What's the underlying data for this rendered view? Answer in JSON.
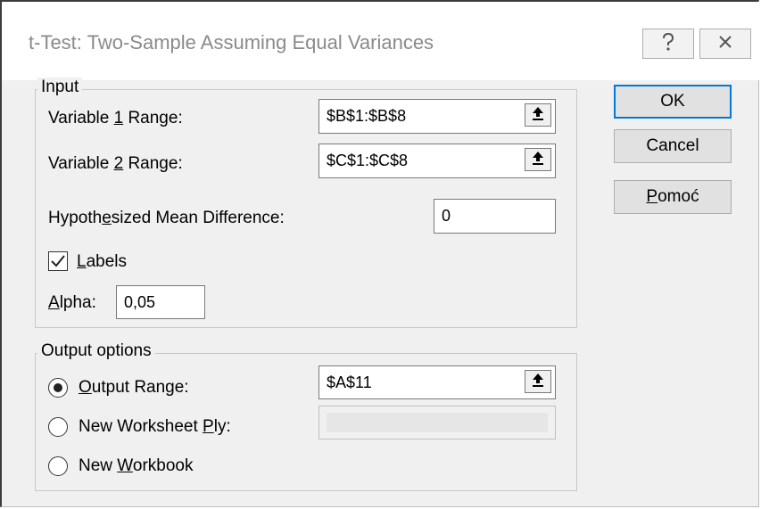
{
  "window": {
    "title": "t-Test: Two-Sample Assuming Equal Variances",
    "help_icon": "?",
    "close_icon": "X"
  },
  "input_group": {
    "legend": "Input",
    "var1_label_pre": "Variable ",
    "var1_label_key": "1",
    "var1_label_post": " Range:",
    "var1_value": "$B$1:$B$8",
    "var2_label_pre": "Variable ",
    "var2_label_key": "2",
    "var2_label_post": " Range:",
    "var2_value": "$C$1:$C$8",
    "hyp_label_pre": "Hypoth",
    "hyp_label_key": "e",
    "hyp_label_post": "sized Mean Difference:",
    "hyp_value": "0",
    "labels_key": "L",
    "labels_post": "abels",
    "labels_checked": true,
    "alpha_key": "A",
    "alpha_post": "lpha:",
    "alpha_value": "0,05"
  },
  "output_group": {
    "legend": "Output options",
    "output_range_key": "O",
    "output_range_post": "utput Range:",
    "output_range_value": "$A$11",
    "output_range_selected": true,
    "new_ws_pre": "New Worksheet ",
    "new_ws_key": "P",
    "new_ws_post": "ly:",
    "new_ws_value": "",
    "new_wb_pre": "New ",
    "new_wb_key": "W",
    "new_wb_post": "orkbook"
  },
  "buttons": {
    "ok": "OK",
    "cancel": "Cancel",
    "help_key": "P",
    "help_post": "omoć"
  },
  "icons": {
    "collapse": "range-collapse-arrow-icon",
    "help": "question-mark-icon",
    "close": "close-x-icon"
  },
  "colors": {
    "default_button_border": "#0078d7",
    "dialog_bg": "#f0f0f0",
    "title_text": "#8a8a8a"
  }
}
